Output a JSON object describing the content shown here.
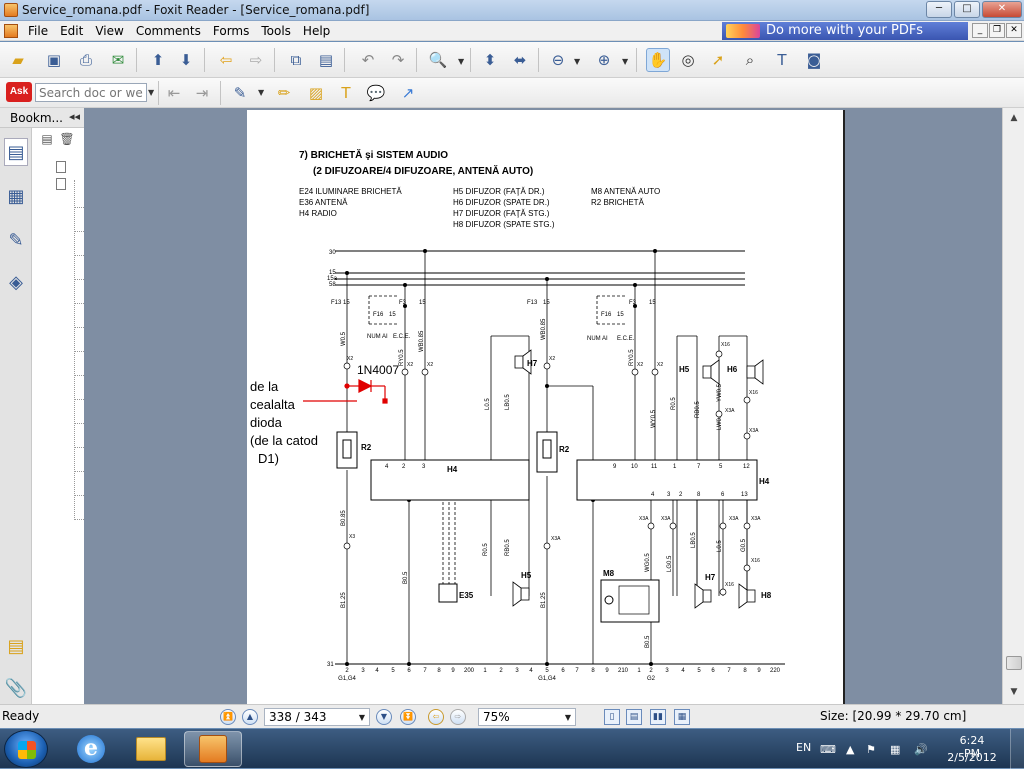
{
  "window": {
    "title": "Service_romana.pdf - Foxit Reader - [Service_romana.pdf]",
    "controls": [
      "─",
      "□",
      "✕"
    ]
  },
  "menu": {
    "items": [
      "File",
      "Edit",
      "View",
      "Comments",
      "Forms",
      "Tools",
      "Help"
    ],
    "ad_text": "Do more with your PDFs",
    "mdi_controls": [
      "_",
      "❐",
      "✕"
    ]
  },
  "toolbar2": {
    "ask_logo": "Ask",
    "search_placeholder": "Search doc or web"
  },
  "sidepanel": {
    "header": "Bookm...",
    "collapse": "◂◂"
  },
  "document": {
    "heading1": "7) BRICHETĂ şi SISTEM AUDIO",
    "heading2": "(2 DIFUZOARE/4 DIFUZOARE, ANTENĂ AUTO)",
    "legend_col1": [
      "E24  ILUMINARE BRICHETĂ",
      "E36  ANTENĂ",
      "H4   RADIO"
    ],
    "legend_col2": [
      "H5   DIFUZOR (FAŢĂ DR.)",
      "H6   DIFUZOR (SPATE DR.)",
      "H7   DIFUZOR (FAŢĂ STG.)",
      "H8   DIFUZOR (SPATE STG.)"
    ],
    "legend_col3": [
      "M8   ANTENĂ  AUTO",
      "R2   BRICHETĂ"
    ],
    "bus_labels": [
      "30",
      "15",
      "15a",
      "58"
    ],
    "fuses": {
      "f13": "F13",
      "f3": "F3",
      "f16": "F16",
      "pin15": "15",
      "numai": "NUM AI",
      "ece": "E.C.E."
    },
    "components": {
      "h4": "H4",
      "r2": "R2",
      "h5": "H5",
      "h6": "H6",
      "h7": "H7",
      "h8": "H8",
      "e35": "E35",
      "m8": "M8"
    },
    "wires": [
      "W0.5",
      "RY0.5",
      "WB0.85",
      "L0.5",
      "LB0.5",
      "WB0.85",
      "RY0.5",
      "WY0.5",
      "R0.5",
      "RB0.5",
      "YW0.5",
      "LW0.5",
      "B0.85",
      "B0.5",
      "B1.25",
      "R0.5",
      "RB0.5",
      "WG0.5",
      "LG0.5",
      "LB0.5",
      "L0.5",
      "G0.5",
      "B0.5"
    ],
    "connectors": [
      "X2",
      "X3",
      "X3A",
      "X16"
    ],
    "h4_left_pins": [
      "4",
      "2",
      "3"
    ],
    "h4_right_top_pins": [
      "9",
      "10",
      "11",
      "1",
      "7",
      "5",
      "12"
    ],
    "h4_right_bottom_pins": [
      "4",
      "3",
      "2",
      "8",
      "6",
      "13"
    ],
    "ground_label": "31",
    "ground_pins_left": [
      "2",
      "3",
      "4",
      "5",
      "6",
      "7",
      "8",
      "9",
      "200",
      "1",
      "2",
      "3",
      "4",
      "5",
      "6",
      "7"
    ],
    "ground_pins_right": [
      "8",
      "9",
      "210",
      "1",
      "2",
      "3",
      "4",
      "5",
      "6",
      "7",
      "8",
      "9",
      "220"
    ],
    "ground_refs": [
      "G1,G4",
      "G1,G4",
      "G2"
    ],
    "annotation_diode": "1N4007",
    "annotation_note": [
      "de la",
      "cealalta",
      "dioda",
      "(de la catod",
      "D1)"
    ]
  },
  "status": {
    "ready": "Ready",
    "page": "338 / 343",
    "zoom": "75%",
    "size": "Size: [20.99 * 29.70 cm]"
  },
  "taskbar": {
    "lang": "EN",
    "time": "6:24 PM",
    "date": "2/5/2012"
  },
  "colors": {
    "annotation": "#e00000",
    "taskbar": "#1d3552",
    "viewer_bg": "#7f8ea3"
  }
}
